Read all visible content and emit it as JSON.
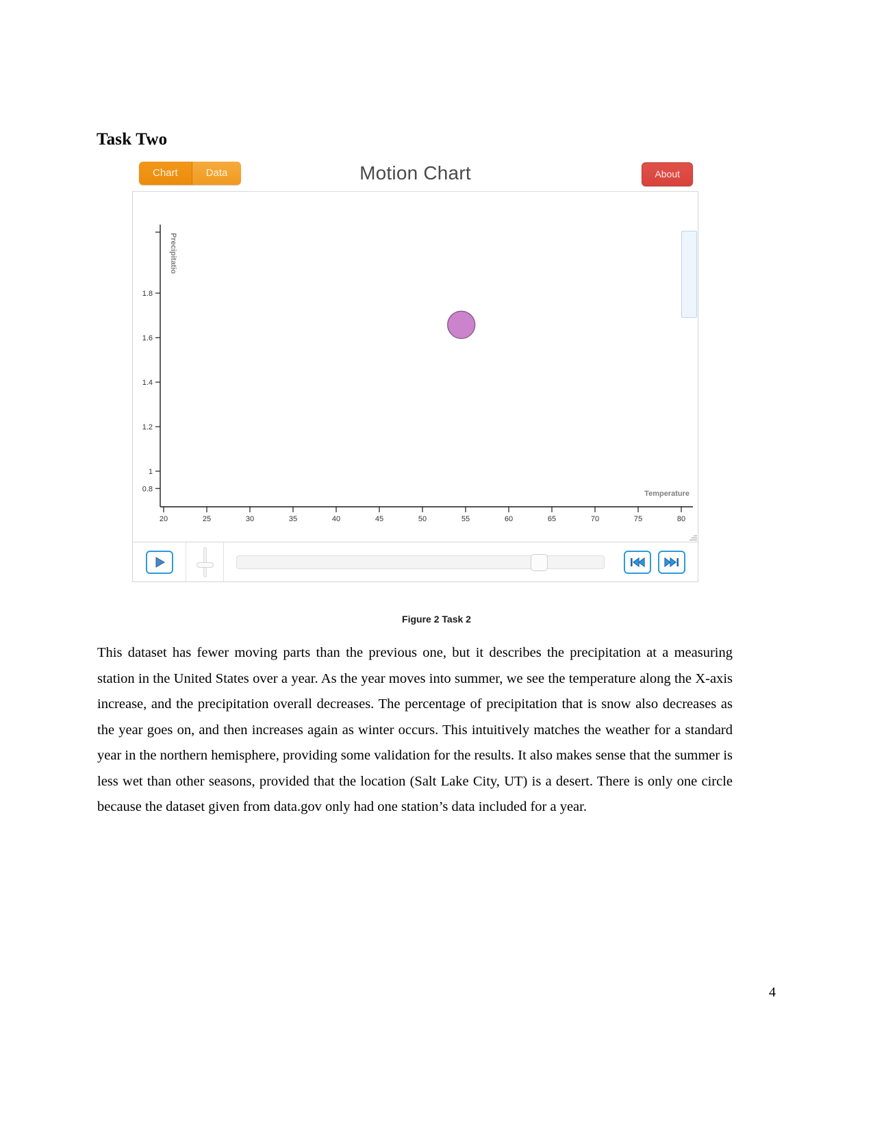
{
  "document": {
    "heading": "Task Two",
    "figure_caption": "Figure 2 Task 2",
    "page_number": "4",
    "body": "This dataset has fewer moving parts than the previous one, but it describes the precipitation at a measuring station in the United States over a year. As the year moves into summer, we see the temperature along the X-axis increase, and the precipitation overall decreases. The percentage of precipitation that is snow also decreases as the year goes on, and then increases again as winter occurs. This intuitively matches the weather for a standard year in the northern hemisphere, providing some validation for the results. It also makes sense that the summer is less wet than other seasons, provided that the location (Salt Lake City, UT) is a desert. There is only one circle because the dataset given from data.gov only had one station’s data included for a year."
  },
  "app": {
    "title": "Motion Chart",
    "tabs": [
      {
        "label": "Chart",
        "active": true
      },
      {
        "label": "Data",
        "active": false
      }
    ],
    "about_label": "About",
    "colors": {
      "tab_chart": "#ec8c0c",
      "tab_data": "#f09a20",
      "about": "#d8433c",
      "accent_blue": "#2e9bd6",
      "bubble": "#c779c7",
      "bubble_stroke": "#8a5a8a",
      "legend_panel": "#eef5fd"
    }
  },
  "player": {
    "play_label": "play",
    "speed_label": "speed",
    "skip_back_label": "skip-back",
    "skip_forward_label": "skip-forward",
    "timeline_position_percent": 80
  },
  "chart_data": {
    "type": "scatter",
    "title": "Motion Chart",
    "xlabel": "Temperature",
    "ylabel": "Precipitatio",
    "xlim": [
      18,
      82
    ],
    "ylim": [
      0.72,
      1.92
    ],
    "xticks": [
      20,
      25,
      30,
      35,
      40,
      45,
      50,
      55,
      60,
      65,
      70,
      75,
      80
    ],
    "yticks": [
      0.8,
      1.0,
      1.2,
      1.4,
      1.6,
      1.8
    ],
    "grid": false,
    "legend": "right",
    "points": [
      {
        "x": 54.5,
        "y": 1.515,
        "size": 20,
        "color": "#c779c7"
      }
    ]
  }
}
